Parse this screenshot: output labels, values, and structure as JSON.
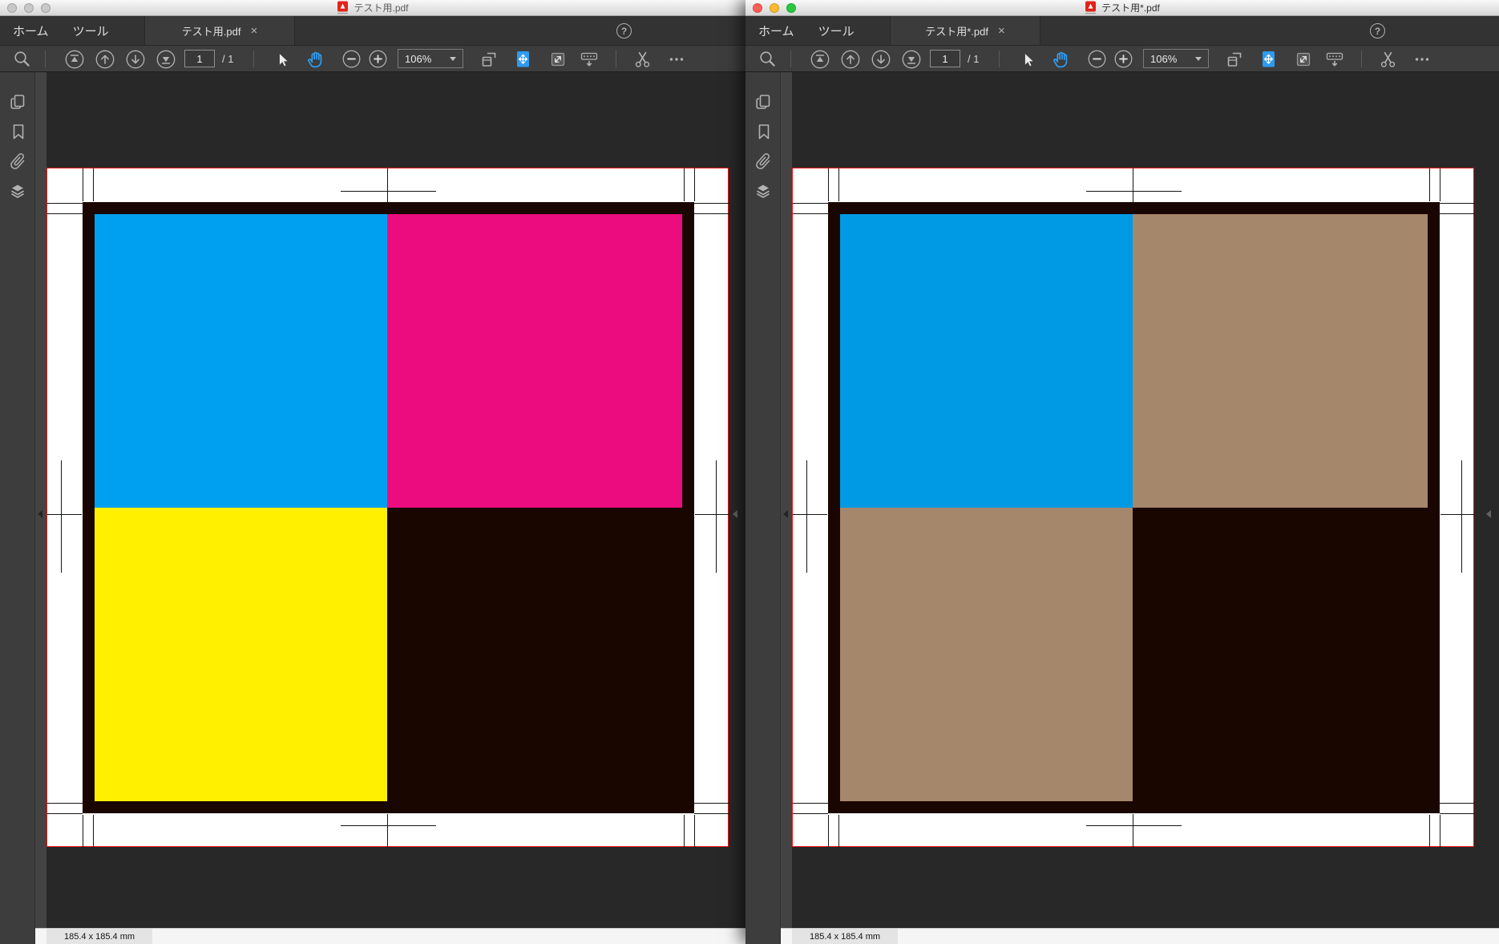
{
  "windows": [
    {
      "title": "テスト用.pdf",
      "active": false,
      "menu_home": "ホーム",
      "menu_tools": "ツール",
      "tab_label": "テスト用.pdf",
      "tab_close": "×",
      "help_glyph": "?",
      "page_number": "1",
      "page_count": "/ 1",
      "zoom_level": "106%",
      "dimensions_label": "185.4 x 185.4 mm",
      "lights": [
        "#c8c8c8",
        "#c8c8c8",
        "#c8c8c8"
      ],
      "quad_colors": {
        "top_left": "#00A0F0",
        "top_right": "#ED0C7F",
        "bottom_left": "#FFF000",
        "frame": "#190601"
      }
    },
    {
      "title": "テスト用*.pdf",
      "active": true,
      "menu_home": "ホーム",
      "menu_tools": "ツール",
      "tab_label": "テスト用*.pdf",
      "tab_close": "×",
      "help_glyph": "?",
      "page_number": "1",
      "page_count": "/ 1",
      "zoom_level": "106%",
      "dimensions_label": "185.4 x 185.4 mm",
      "lights": [
        "#FF5F57",
        "#FEBC2E",
        "#28C840"
      ],
      "quad_colors": {
        "top_left": "#0099E4",
        "top_right": "#A5876C",
        "bottom_left": "#A5876C",
        "frame": "#190601"
      }
    }
  ],
  "accent_colors": {
    "active_tool_blue": "#2E9BEF",
    "crop_box_red": "#EE1111",
    "pdf_brand_red": "#E2231A"
  }
}
